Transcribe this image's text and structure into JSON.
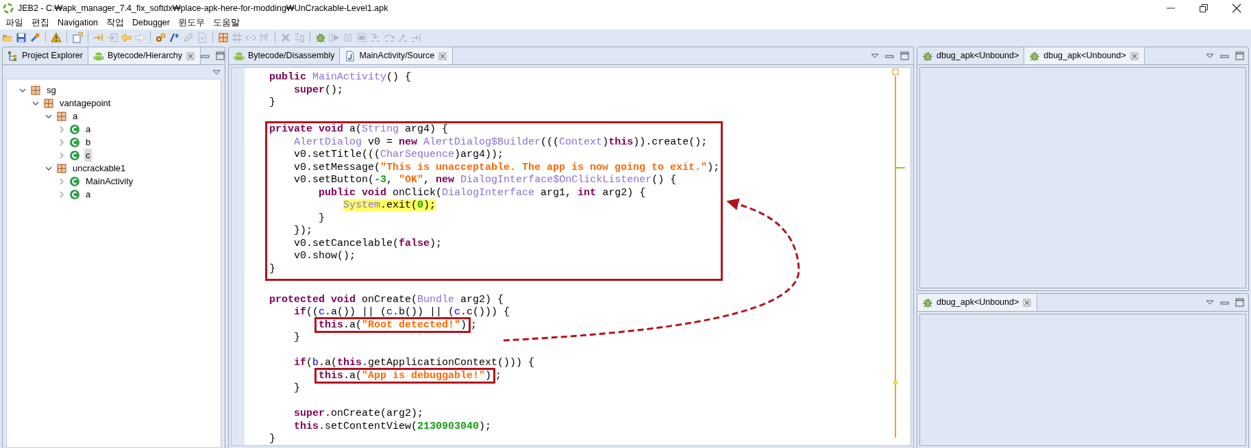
{
  "window": {
    "title": "JEB2 - C:₩apk_manager_7.4_fix_softdx₩place-apk-here-for-modding₩UnCrackable-Level1.apk"
  },
  "menu": [
    "파일",
    "편집",
    "Navigation",
    "작업",
    "Debugger",
    "윈도우",
    "도움말"
  ],
  "toolbar": [
    [
      {
        "disabled": false
      },
      {
        "disabled": false
      },
      {
        "disabled": false
      }
    ],
    [
      {
        "disabled": false
      }
    ],
    [
      {
        "disabled": false
      }
    ],
    [
      {
        "disabled": false
      },
      {
        "disabled": true
      },
      {
        "disabled": false
      },
      {
        "disabled": true
      }
    ],
    [
      {
        "disabled": false
      },
      {
        "disabled": false
      },
      {
        "disabled": true
      },
      {
        "disabled": true
      }
    ],
    [
      {
        "disabled": false
      },
      {
        "disabled": true
      },
      {
        "disabled": true
      },
      {
        "disabled": true
      }
    ],
    [
      {
        "disabled": true
      },
      {
        "disabled": true
      }
    ],
    [
      {
        "disabled": false
      },
      {
        "disabled": true
      },
      {
        "disabled": true
      },
      {
        "disabled": true
      },
      {
        "disabled": true
      },
      {
        "disabled": true
      },
      {
        "disabled": true
      },
      {
        "disabled": true
      }
    ]
  ],
  "left_panel": {
    "tabs": [
      {
        "label": "Project Explorer",
        "kind": "explorer",
        "selected": false
      },
      {
        "label": "Bytecode/Hierarchy",
        "kind": "bytecode",
        "selected": true
      }
    ],
    "tree": [
      {
        "label": "sg",
        "kind": "package",
        "expanded": true,
        "selected": false,
        "children": [
          {
            "label": "vantagepoint",
            "kind": "package",
            "expanded": true,
            "selected": false,
            "children": [
              {
                "label": "a",
                "kind": "package",
                "expanded": true,
                "selected": false,
                "children": [
                  {
                    "label": "a",
                    "kind": "class",
                    "expanded": false,
                    "selected": false
                  },
                  {
                    "label": "b",
                    "kind": "class",
                    "expanded": false,
                    "selected": false
                  },
                  {
                    "label": "c",
                    "kind": "class",
                    "expanded": false,
                    "selected": true
                  }
                ]
              },
              {
                "label": "uncrackable1",
                "kind": "package",
                "expanded": true,
                "selected": false,
                "children": [
                  {
                    "label": "MainActivity",
                    "kind": "class",
                    "expanded": false,
                    "selected": false
                  },
                  {
                    "label": "a",
                    "kind": "class",
                    "expanded": false,
                    "selected": false
                  }
                ]
              }
            ]
          }
        ]
      }
    ]
  },
  "editor": {
    "tabs": [
      {
        "label": "Bytecode/Disassembly",
        "kind": "bytecode",
        "selected": false
      },
      {
        "label": "MainActivity/Source",
        "kind": "source",
        "selected": true
      }
    ],
    "code": [
      {
        "kind": "plain",
        "lines": [
          {
            "kind": "code",
            "tokens": [
              {
                "kind": "kw",
                "text": "    public"
              },
              {
                "kind": "type",
                "text": " MainActivity"
              },
              {
                "kind": "plain",
                "text": "() {"
              }
            ]
          },
          {
            "kind": "code",
            "tokens": [
              {
                "kind": "kw",
                "text": "        super"
              },
              {
                "kind": "plain",
                "text": "();"
              }
            ]
          },
          {
            "kind": "code",
            "tokens": [
              {
                "kind": "plain",
                "text": "    }"
              }
            ]
          },
          {
            "kind": "blank"
          }
        ]
      },
      {
        "kind": "framed",
        "lines": [
          {
            "kind": "code",
            "tokens": [
              {
                "kind": "kw",
                "text": "    private void"
              },
              {
                "kind": "plain",
                "text": " a("
              },
              {
                "kind": "type",
                "text": "String"
              },
              {
                "kind": "plain",
                "text": " arg4) {"
              }
            ]
          },
          {
            "kind": "code",
            "tokens": [
              {
                "kind": "type",
                "text": "        AlertDialog"
              },
              {
                "kind": "plain",
                "text": " v0 = "
              },
              {
                "kind": "kw",
                "text": "new"
              },
              {
                "kind": "type",
                "text": " AlertDialog$Builder"
              },
              {
                "kind": "plain",
                "text": "((("
              },
              {
                "kind": "type",
                "text": "Context"
              },
              {
                "kind": "plain",
                "text": ")"
              },
              {
                "kind": "kw",
                "text": "this"
              },
              {
                "kind": "plain",
                "text": ")).create();"
              }
            ]
          },
          {
            "kind": "code",
            "tokens": [
              {
                "kind": "plain",
                "text": "        v0.setTitle((("
              },
              {
                "kind": "type",
                "text": "CharSequence"
              },
              {
                "kind": "plain",
                "text": ")arg4));"
              }
            ]
          },
          {
            "kind": "code",
            "tokens": [
              {
                "kind": "plain",
                "text": "        v0.setMessage("
              },
              {
                "kind": "str",
                "text": "\"This is unacceptable. The app is now going to exit.\""
              },
              {
                "kind": "plain",
                "text": ");"
              }
            ]
          },
          {
            "kind": "code",
            "tokens": [
              {
                "kind": "plain",
                "text": "        v0.setButton("
              },
              {
                "kind": "num",
                "text": "-3"
              },
              {
                "kind": "plain",
                "text": ", "
              },
              {
                "kind": "str",
                "text": "\"OK\""
              },
              {
                "kind": "plain",
                "text": ", "
              },
              {
                "kind": "kw",
                "text": "new"
              },
              {
                "kind": "type",
                "text": " DialogInterface$OnClickListener"
              },
              {
                "kind": "plain",
                "text": "() {"
              }
            ]
          },
          {
            "kind": "code",
            "tokens": [
              {
                "kind": "kw",
                "text": "            public void"
              },
              {
                "kind": "plain",
                "text": " onClick("
              },
              {
                "kind": "type",
                "text": "DialogInterface"
              },
              {
                "kind": "plain",
                "text": " arg1, "
              },
              {
                "kind": "kw",
                "text": "int"
              },
              {
                "kind": "plain",
                "text": " arg2) {"
              }
            ]
          },
          {
            "kind": "code",
            "tokens": [
              {
                "kind": "highlighted",
                "tokens": [
                  {
                    "kind": "type",
                    "text": "                System"
                  },
                  {
                    "kind": "plain",
                    "text": ".exit("
                  },
                  {
                    "kind": "num",
                    "text": "0"
                  },
                  {
                    "kind": "plain",
                    "text": ");"
                  }
                ]
              }
            ]
          },
          {
            "kind": "code",
            "tokens": [
              {
                "kind": "plain",
                "text": "            }"
              }
            ]
          },
          {
            "kind": "code",
            "tokens": [
              {
                "kind": "plain",
                "text": "        });"
              }
            ]
          },
          {
            "kind": "code",
            "tokens": [
              {
                "kind": "plain",
                "text": "        v0.setCancelable("
              },
              {
                "kind": "kw",
                "text": "false"
              },
              {
                "kind": "plain",
                "text": ");"
              }
            ]
          },
          {
            "kind": "code",
            "tokens": [
              {
                "kind": "plain",
                "text": "        v0.show();"
              }
            ]
          },
          {
            "kind": "code",
            "tokens": [
              {
                "kind": "plain",
                "text": "    }"
              }
            ]
          }
        ]
      },
      {
        "kind": "plain",
        "lines": [
          {
            "kind": "blank"
          },
          {
            "kind": "code",
            "tokens": [
              {
                "kind": "kw",
                "text": "    protected void"
              },
              {
                "kind": "plain",
                "text": " onCreate("
              },
              {
                "kind": "type",
                "text": "Bundle"
              },
              {
                "kind": "plain",
                "text": " arg2) {"
              }
            ]
          },
          {
            "kind": "code",
            "tokens": [
              {
                "kind": "kw",
                "text": "        if"
              },
              {
                "kind": "plain",
                "text": "(("
              },
              {
                "kind": "ref",
                "text": "c"
              },
              {
                "kind": "plain",
                "text": ".a()) || ("
              },
              {
                "kind": "ref",
                "text": "c"
              },
              {
                "kind": "plain",
                "text": ".b()) || ("
              },
              {
                "kind": "ref",
                "text": "c"
              },
              {
                "kind": "plain",
                "text": ".c())) {"
              }
            ]
          },
          {
            "kind": "code",
            "tokens": [
              {
                "kind": "boxed",
                "tokens": [
                  {
                    "kind": "kw",
                    "text": "            this"
                  },
                  {
                    "kind": "plain",
                    "text": ".a("
                  },
                  {
                    "kind": "str",
                    "text": "\"Root detected!\""
                  },
                  {
                    "kind": "plain",
                    "text": ")"
                  }
                ]
              },
              {
                "kind": "plain",
                "text": ";"
              }
            ]
          },
          {
            "kind": "code",
            "tokens": [
              {
                "kind": "plain",
                "text": "        }"
              }
            ]
          },
          {
            "kind": "blank"
          },
          {
            "kind": "code",
            "tokens": [
              {
                "kind": "kw",
                "text": "        if"
              },
              {
                "kind": "plain",
                "text": "("
              },
              {
                "kind": "ref",
                "text": "b"
              },
              {
                "kind": "plain",
                "text": ".a("
              },
              {
                "kind": "kw",
                "text": "this"
              },
              {
                "kind": "plain",
                "text": ".getApplicationContext())) {"
              }
            ]
          },
          {
            "kind": "code",
            "tokens": [
              {
                "kind": "boxed",
                "tokens": [
                  {
                    "kind": "kw",
                    "text": "            this"
                  },
                  {
                    "kind": "plain",
                    "text": ".a("
                  },
                  {
                    "kind": "str",
                    "text": "\"App is debuggable!\""
                  },
                  {
                    "kind": "plain",
                    "text": ")"
                  }
                ]
              },
              {
                "kind": "plain",
                "text": ";"
              }
            ]
          },
          {
            "kind": "code",
            "tokens": [
              {
                "kind": "plain",
                "text": "        }"
              }
            ]
          },
          {
            "kind": "blank"
          },
          {
            "kind": "code",
            "tokens": [
              {
                "kind": "kw",
                "text": "        super"
              },
              {
                "kind": "plain",
                "text": ".onCreate(arg2);"
              }
            ]
          },
          {
            "kind": "code",
            "tokens": [
              {
                "kind": "kw",
                "text": "        this"
              },
              {
                "kind": "plain",
                "text": ".setContentView("
              },
              {
                "kind": "num",
                "text": "2130903040"
              },
              {
                "kind": "plain",
                "text": ");"
              }
            ]
          },
          {
            "kind": "code",
            "tokens": [
              {
                "kind": "plain",
                "text": "    }"
              }
            ]
          }
        ]
      }
    ]
  },
  "debug_top": {
    "tabs": [
      {
        "label": "dbug_apk<Unbound>",
        "selected": false
      },
      {
        "label": "dbug_apk<Unbound>",
        "selected": true
      }
    ]
  },
  "debug_bottom": {
    "tabs": [
      {
        "label": "dbug_apk<Unbound>",
        "selected": true
      }
    ]
  }
}
